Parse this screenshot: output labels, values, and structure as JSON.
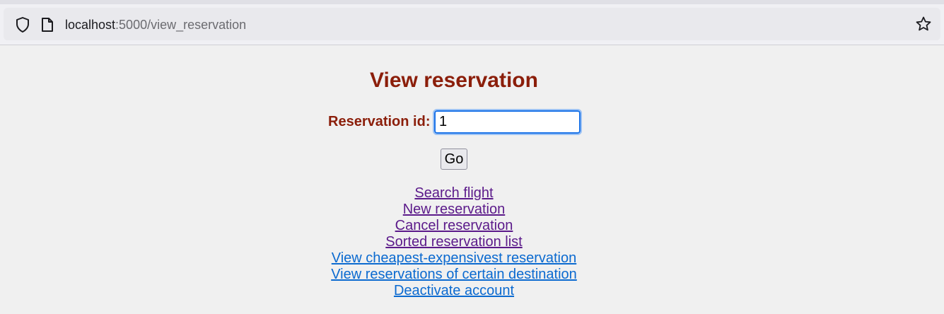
{
  "browser": {
    "url_host": "localhost",
    "url_rest": ":5000/view_reservation"
  },
  "page": {
    "title": "View reservation",
    "reservation_label": "Reservation id:",
    "reservation_value": "1",
    "go_label": "Go"
  },
  "links": [
    {
      "label": "Search flight",
      "visited": true
    },
    {
      "label": "New reservation",
      "visited": true
    },
    {
      "label": "Cancel reservation",
      "visited": true
    },
    {
      "label": "Sorted reservation list",
      "visited": true
    },
    {
      "label": "View cheapest-expensivest reservation",
      "visited": false
    },
    {
      "label": "View reservations of certain destination",
      "visited": false
    },
    {
      "label": "Deactivate account",
      "visited": false
    }
  ],
  "colors": {
    "heading": "#8b1e0a",
    "visited_link": "#5b1a8a",
    "link": "#0b6ad0"
  }
}
